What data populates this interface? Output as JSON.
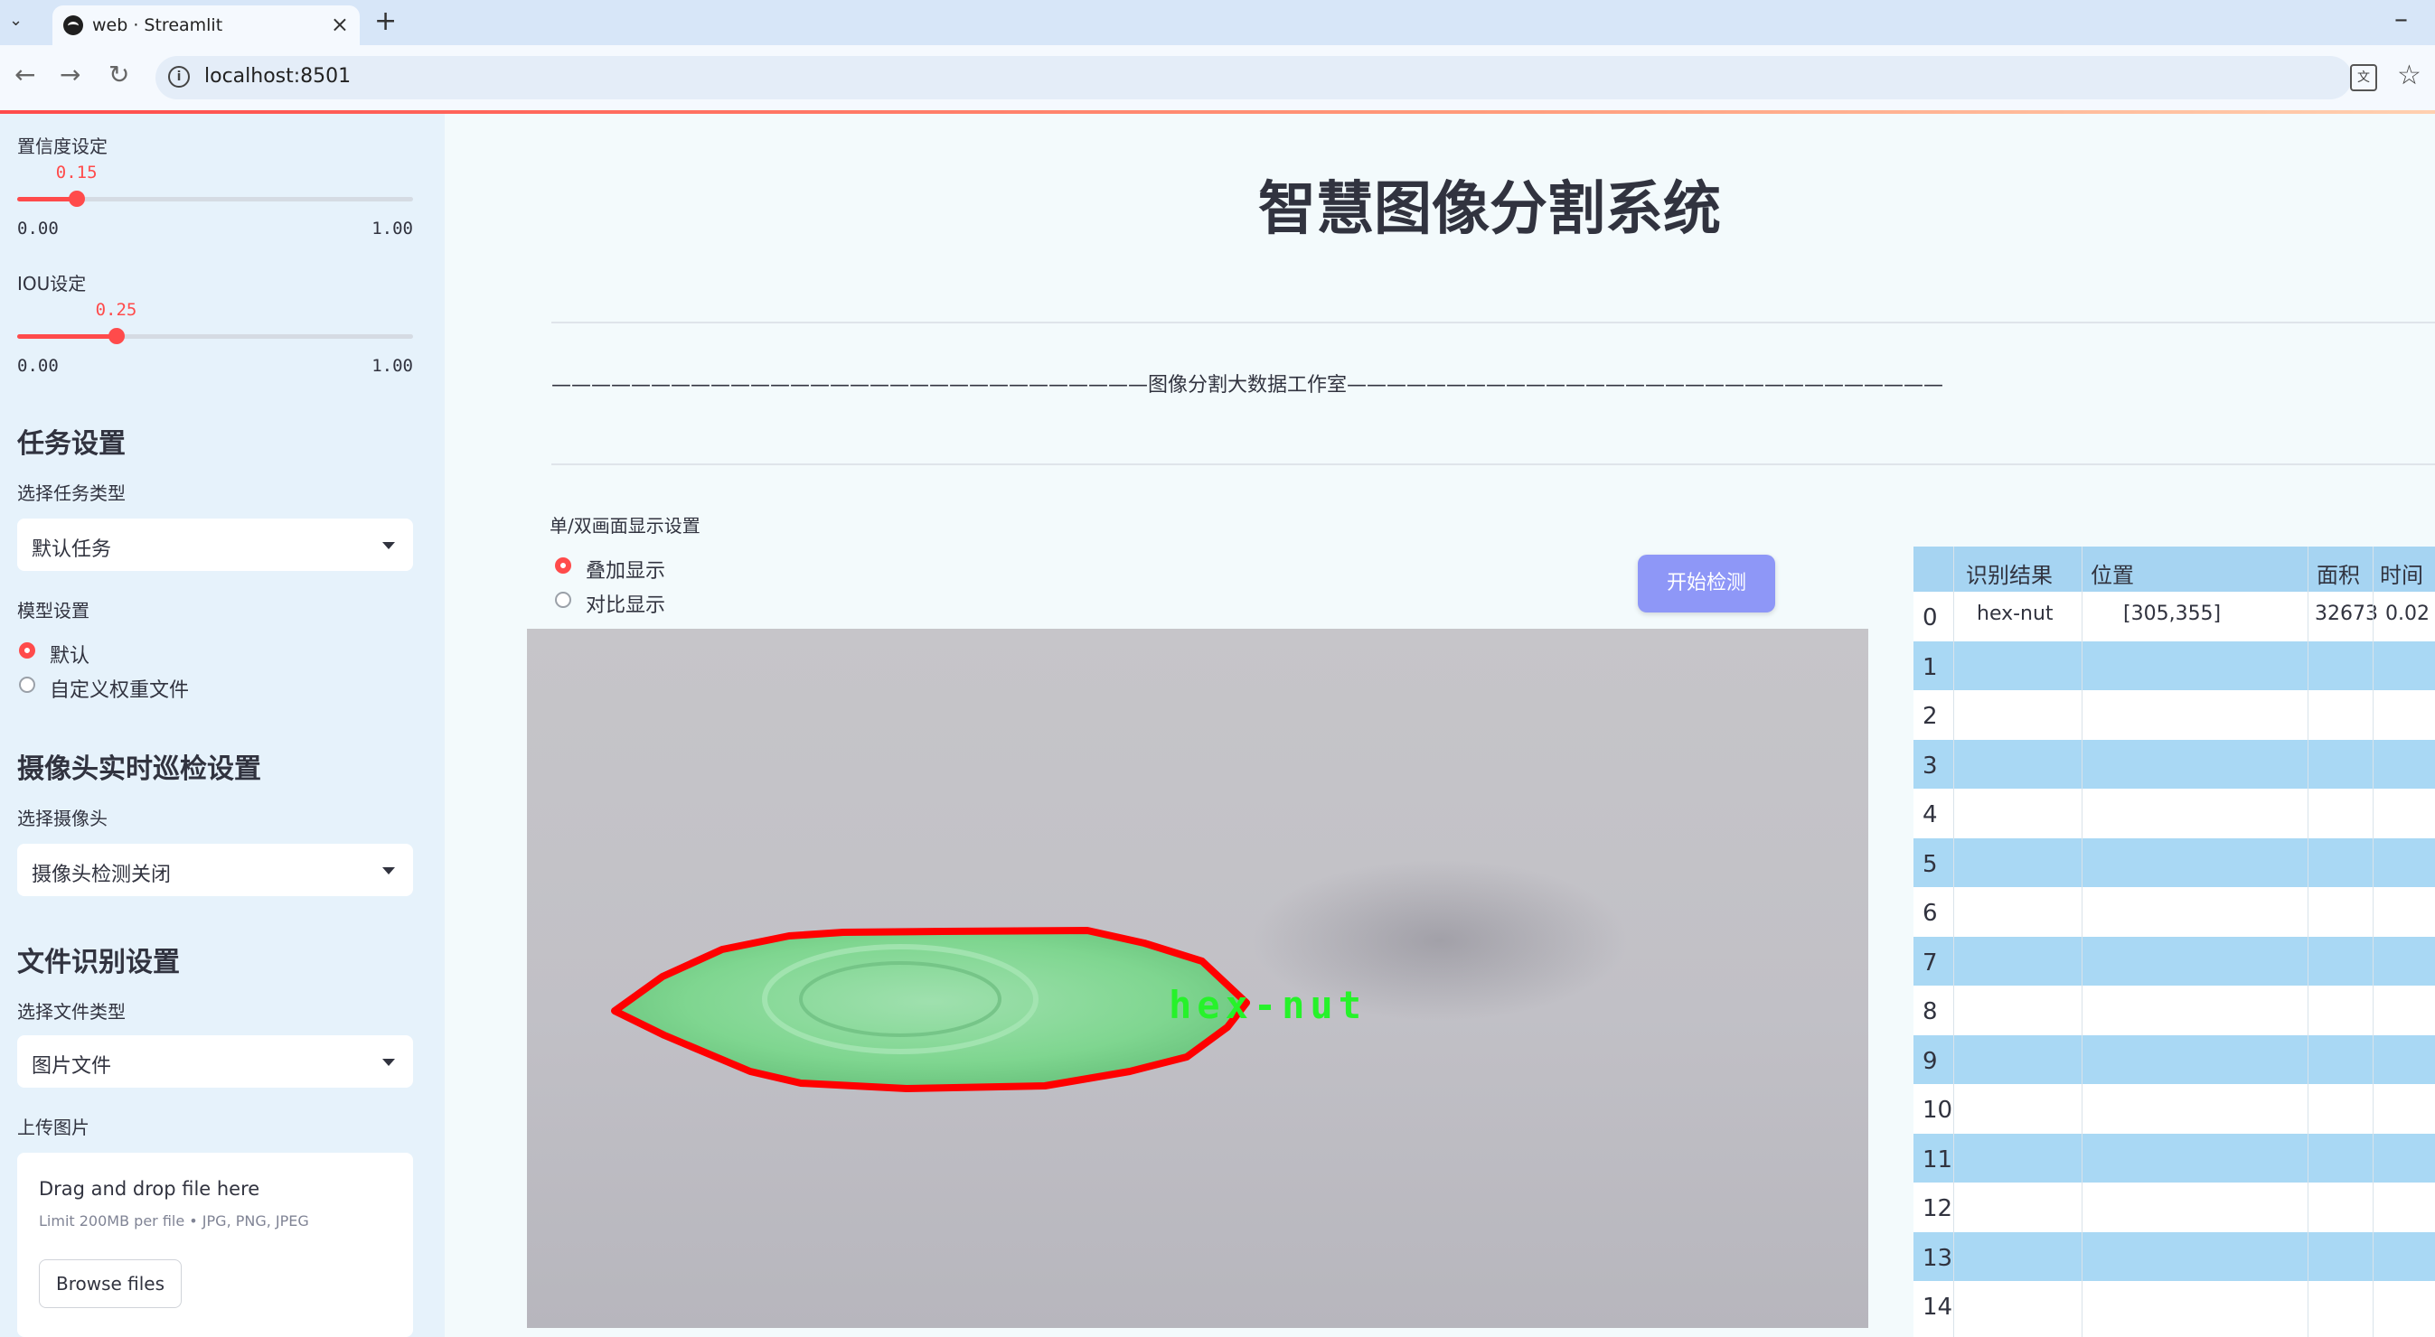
{
  "browser": {
    "tab_title": "web · Streamlit",
    "url": "localhost:8501"
  },
  "sidebar": {
    "conf_label": "置信度设定",
    "conf_slider": {
      "value": "0.15",
      "min": "0.00",
      "max": "1.00",
      "fraction": 0.15
    },
    "iou_label": "IOU设定",
    "iou_slider": {
      "value": "0.25",
      "min": "0.00",
      "max": "1.00",
      "fraction": 0.25
    },
    "task_heading": "任务设置",
    "task_type_label": "选择任务类型",
    "task_type_value": "默认任务",
    "model_label": "模型设置",
    "model_options": [
      "默认",
      "自定义权重文件"
    ],
    "camera_heading": "摄像头实时巡检设置",
    "camera_label": "选择摄像头",
    "camera_value": "摄像头检测关闭",
    "file_heading": "文件识别设置",
    "file_type_label": "选择文件类型",
    "file_type_value": "图片文件",
    "upload_label": "上传图片",
    "upload_drag": "Drag and drop file here",
    "upload_limit": "Limit 200MB per file • JPG, PNG, JPEG",
    "upload_button": "Browse files"
  },
  "main": {
    "title": "智慧图像分割系统",
    "studio_line": "——————————————————————————————图像分割大数据工作室——————————————————————————————",
    "display_mode_label": "单/双画面显示设置",
    "display_options": [
      "叠加显示",
      "对比显示"
    ],
    "start_button": "开始检测",
    "detection_label": "hex-nut"
  },
  "table": {
    "headers": [
      "识别结果",
      "位置",
      "面积",
      "时间"
    ],
    "rows": [
      {
        "index": "0",
        "result": "hex-nut",
        "position": "[305,355]",
        "area": "32673",
        "time": "0.02"
      },
      {
        "index": "1"
      },
      {
        "index": "2"
      },
      {
        "index": "3"
      },
      {
        "index": "4"
      },
      {
        "index": "5"
      },
      {
        "index": "6"
      },
      {
        "index": "7"
      },
      {
        "index": "8"
      },
      {
        "index": "9"
      },
      {
        "index": "10"
      },
      {
        "index": "11"
      },
      {
        "index": "12"
      },
      {
        "index": "13"
      },
      {
        "index": "14"
      }
    ]
  },
  "colors": {
    "accent": "#ff4b4b",
    "button": "#8e97f7",
    "segment_outline": "#ff0000",
    "segment_fill": "#7fd690",
    "label_text": "#26f22a"
  }
}
